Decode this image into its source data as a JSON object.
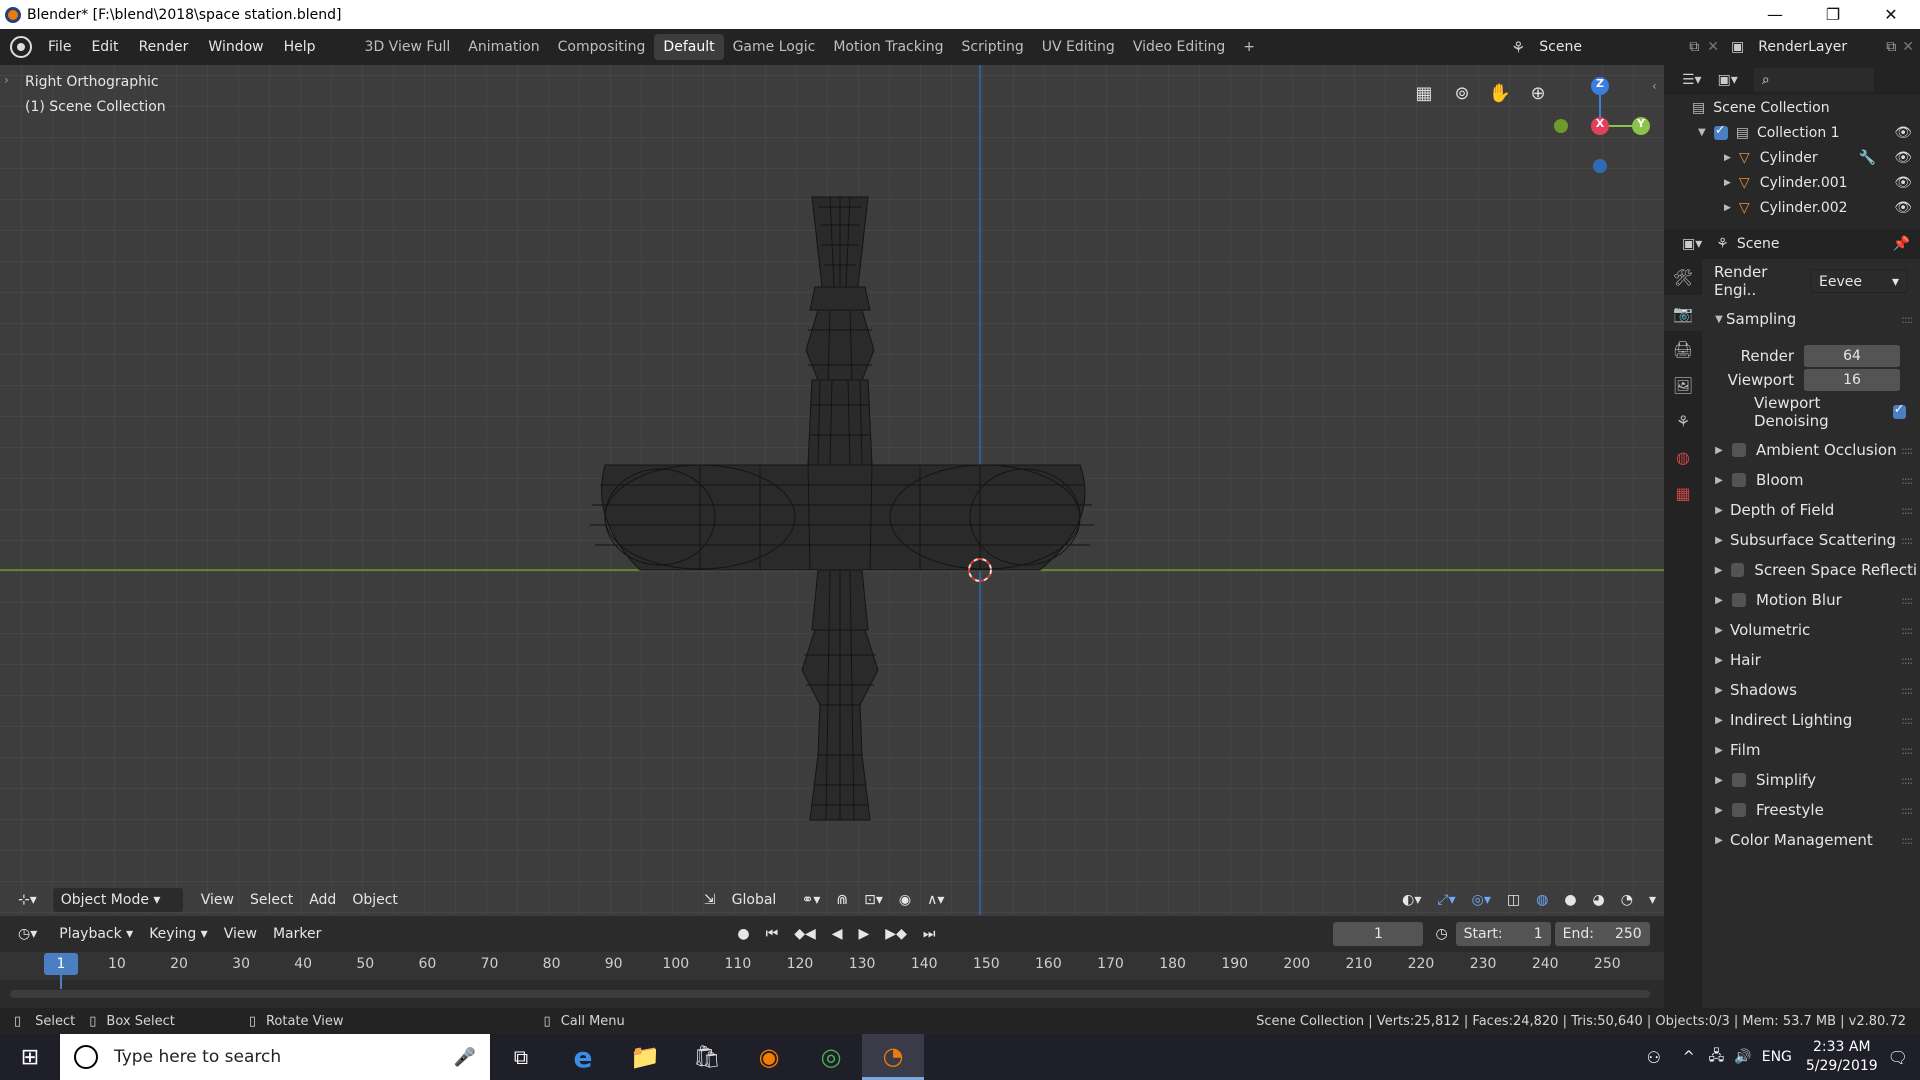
{
  "window": {
    "title": "Blender* [F:\\blend\\2018\\space station.blend]",
    "minimize": "—",
    "maximize": "❐",
    "close": "✕"
  },
  "menubar": {
    "menus": [
      "File",
      "Edit",
      "Render",
      "Window",
      "Help"
    ],
    "workspaces": [
      "3D View Full",
      "Animation",
      "Compositing",
      "Default",
      "Game Logic",
      "Motion Tracking",
      "Scripting",
      "UV Editing",
      "Video Editing"
    ],
    "active_workspace": "Default",
    "add": "+",
    "scene": "Scene",
    "render_layer": "RenderLayer"
  },
  "viewport": {
    "view_name": "Right Orthographic",
    "collection": "(1) Scene Collection",
    "gizmo": {
      "z": "Z",
      "x": "X",
      "y": "Y"
    }
  },
  "viewport_header": {
    "mode": "Object Mode",
    "menus": [
      "View",
      "Select",
      "Add",
      "Object"
    ],
    "orientation": "Global"
  },
  "timeline": {
    "menus": [
      "Playback",
      "Keying",
      "View",
      "Marker"
    ],
    "current_frame": "1",
    "start_label": "Start:",
    "start": "1",
    "end_label": "End:",
    "end": "250",
    "ruler": [
      "1",
      "10",
      "20",
      "30",
      "40",
      "50",
      "60",
      "70",
      "80",
      "90",
      "100",
      "110",
      "120",
      "130",
      "140",
      "150",
      "160",
      "170",
      "180",
      "190",
      "200",
      "210",
      "220",
      "230",
      "240",
      "250"
    ]
  },
  "outliner": {
    "root": "Scene Collection",
    "collection": "Collection 1",
    "objects": [
      "Cylinder",
      "Cylinder.001",
      "Cylinder.002"
    ]
  },
  "properties": {
    "context": "Scene",
    "render_engine_label": "Render Engi..",
    "render_engine": "Eevee",
    "sampling": "Sampling",
    "render_label": "Render",
    "render_samples": "64",
    "viewport_label": "Viewport",
    "viewport_samples": "16",
    "denoising": "Viewport Denoising",
    "panels": [
      {
        "label": "Ambient Occlusion",
        "checkbox": true
      },
      {
        "label": "Bloom",
        "checkbox": true
      },
      {
        "label": "Depth of Field",
        "checkbox": false
      },
      {
        "label": "Subsurface Scattering",
        "checkbox": false
      },
      {
        "label": "Screen Space Reflectio",
        "checkbox": true
      },
      {
        "label": "Motion Blur",
        "checkbox": true
      },
      {
        "label": "Volumetric",
        "checkbox": false
      },
      {
        "label": "Hair",
        "checkbox": false
      },
      {
        "label": "Shadows",
        "checkbox": false
      },
      {
        "label": "Indirect Lighting",
        "checkbox": false
      },
      {
        "label": "Film",
        "checkbox": false
      },
      {
        "label": "Simplify",
        "checkbox": true
      },
      {
        "label": "Freestyle",
        "checkbox": true
      },
      {
        "label": "Color Management",
        "checkbox": false
      }
    ]
  },
  "statusbar": {
    "select": "Select",
    "box_select": "Box Select",
    "rotate": "Rotate View",
    "call_menu": "Call Menu",
    "stats": "Scene Collection | Verts:25,812 | Faces:24,820 | Tris:50,640 | Objects:0/3 | Mem: 53.7 MB | v2.80.72"
  },
  "taskbar": {
    "search_placeholder": "Type here to search",
    "lang": "ENG",
    "time": "2:33 AM",
    "date": "5/29/2019"
  },
  "colors": {
    "x_axis": "#e0405a",
    "y_axis": "#8bc34a",
    "z_axis": "#3c7ee0",
    "accent": "#4a7fc1"
  }
}
